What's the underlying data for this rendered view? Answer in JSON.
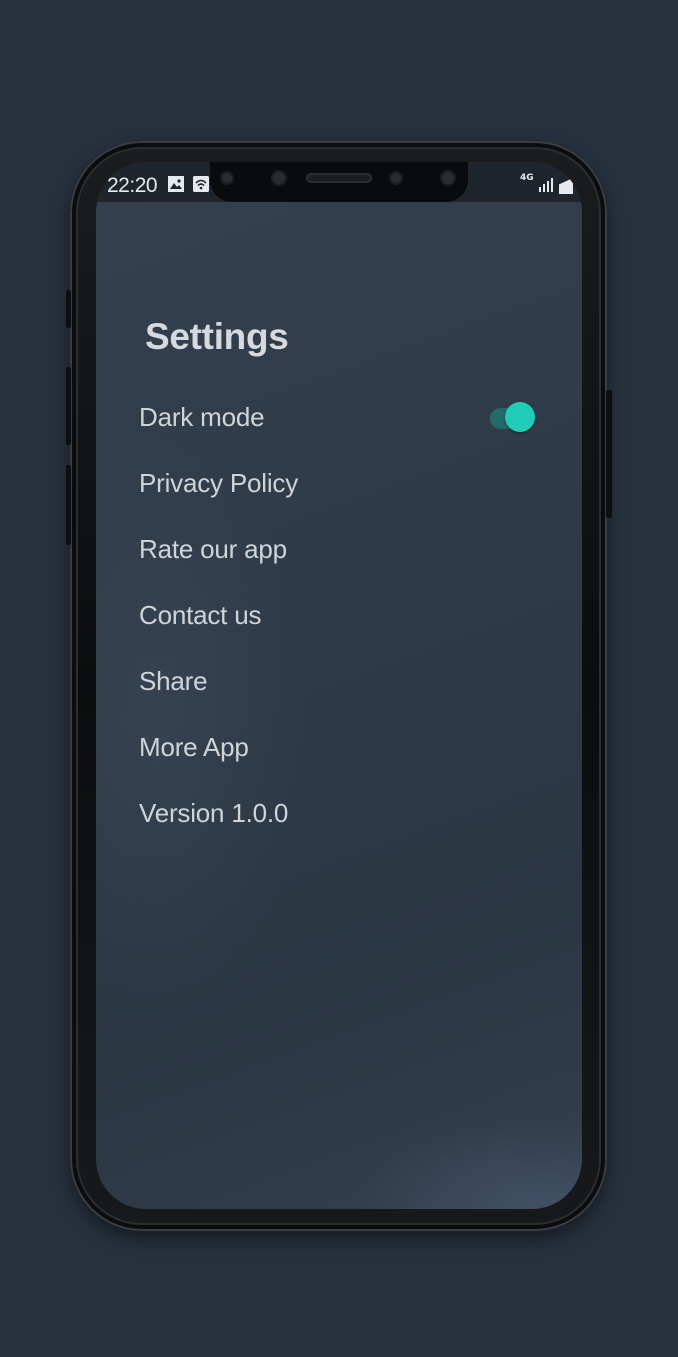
{
  "status_bar": {
    "time": "22:20",
    "network": "4G",
    "icons": [
      "image-icon",
      "wifi-icon",
      "signal-icon",
      "battery-icon"
    ]
  },
  "settings": {
    "title": "Settings",
    "dark_mode_label": "Dark mode",
    "dark_mode_enabled": true,
    "items": [
      {
        "label": "Privacy Policy"
      },
      {
        "label": "Rate our app"
      },
      {
        "label": "Contact us"
      },
      {
        "label": "Share"
      },
      {
        "label": "More App"
      },
      {
        "label": "Version 1.0.0"
      }
    ]
  },
  "colors": {
    "background": "#27313e",
    "screen": "#2f3b49",
    "accent": "#1fcdb7",
    "text": "#d0d4d9"
  }
}
